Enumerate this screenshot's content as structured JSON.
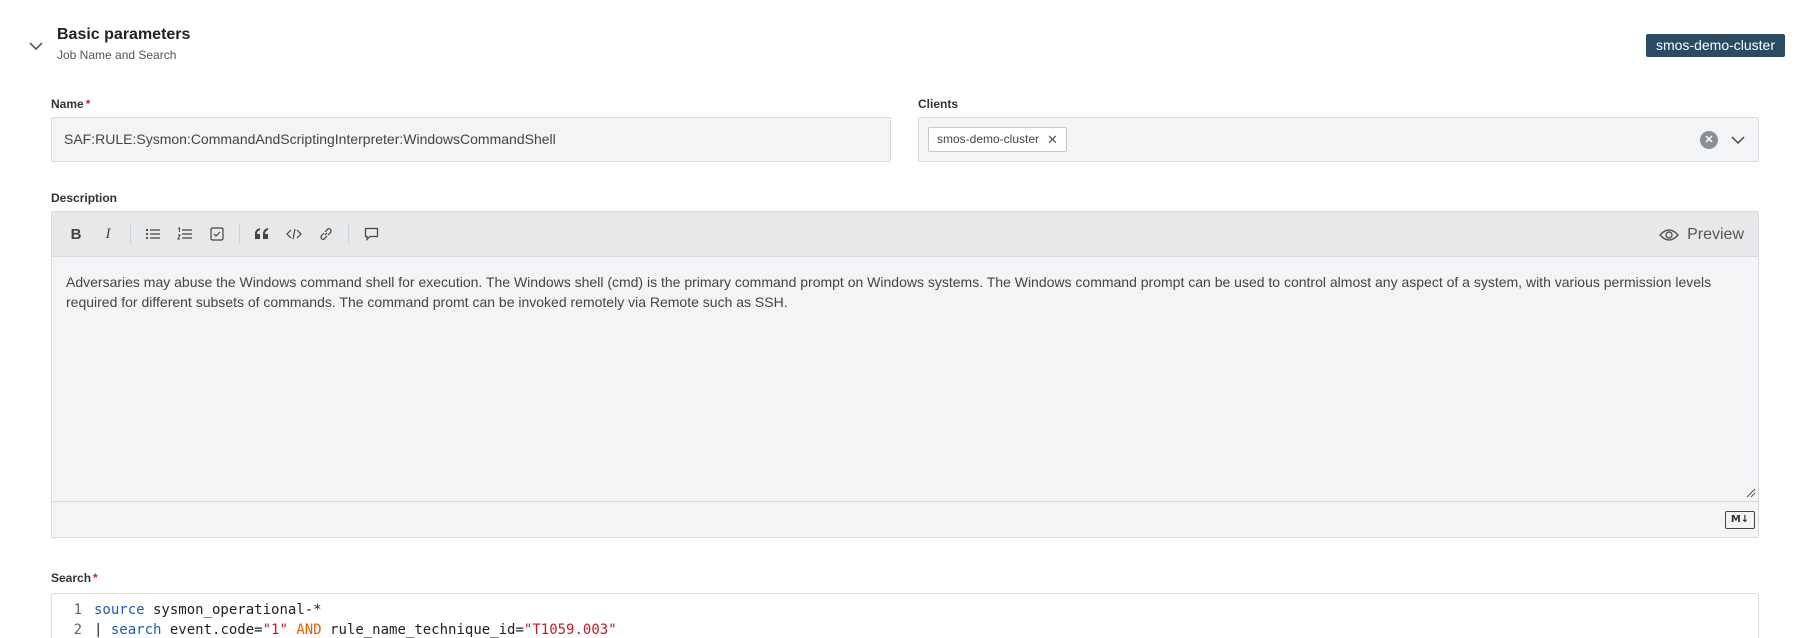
{
  "section": {
    "title": "Basic parameters",
    "subtitle": "Job Name and Search",
    "badge": "smos-demo-cluster"
  },
  "name_field": {
    "label": "Name",
    "required_mark": "*",
    "value": "SAF:RULE:Sysmon:CommandAndScriptingInterpreter:WindowsCommandShell"
  },
  "clients_field": {
    "label": "Clients",
    "chips": [
      "smos-demo-cluster"
    ],
    "chip_remove": "✕",
    "clear": "✕"
  },
  "description": {
    "label": "Description",
    "toolbar": {
      "bold": "B",
      "italic": "I",
      "preview_label": "Preview"
    },
    "text": "Adversaries may abuse the Windows command shell for execution. The Windows shell (cmd) is the primary command prompt on Windows systems. The Windows command prompt can be used to control almost any aspect of a system, with various permission levels required for different subsets of commands. The command promt can be invoked remotely via Remote such as SSH.",
    "markdown_badge": "M↓"
  },
  "search_field": {
    "label": "Search",
    "required_mark": "*",
    "lines": [
      {
        "num": "1",
        "tokens": [
          {
            "t": "source",
            "c": "kw"
          },
          {
            "t": " sysmon_operational-*",
            "c": "plain"
          }
        ]
      },
      {
        "num": "2",
        "tokens": [
          {
            "t": "| ",
            "c": "plain"
          },
          {
            "t": "search",
            "c": "kw"
          },
          {
            "t": " event.code=",
            "c": "plain"
          },
          {
            "t": "\"1\"",
            "c": "str"
          },
          {
            "t": " AND",
            "c": "op"
          },
          {
            "t": " rule_name_technique_id=",
            "c": "plain"
          },
          {
            "t": "\"T1059.003\"",
            "c": "str"
          }
        ]
      }
    ]
  },
  "icons": {
    "chevron": "chevron-down-icon",
    "eye": "eye-icon",
    "bullet_list": "bullet-list-icon",
    "numbered_list": "numbered-list-icon",
    "checklist": "checkbox-list-icon",
    "quote": "quote-icon",
    "code": "code-icon",
    "link": "link-icon",
    "comment": "comment-icon"
  },
  "colors": {
    "badge_bg": "#2b4a63",
    "required": "#dd2222",
    "keyword": "#1a5fb4",
    "string": "#c01c28",
    "operator": "#e66100"
  }
}
